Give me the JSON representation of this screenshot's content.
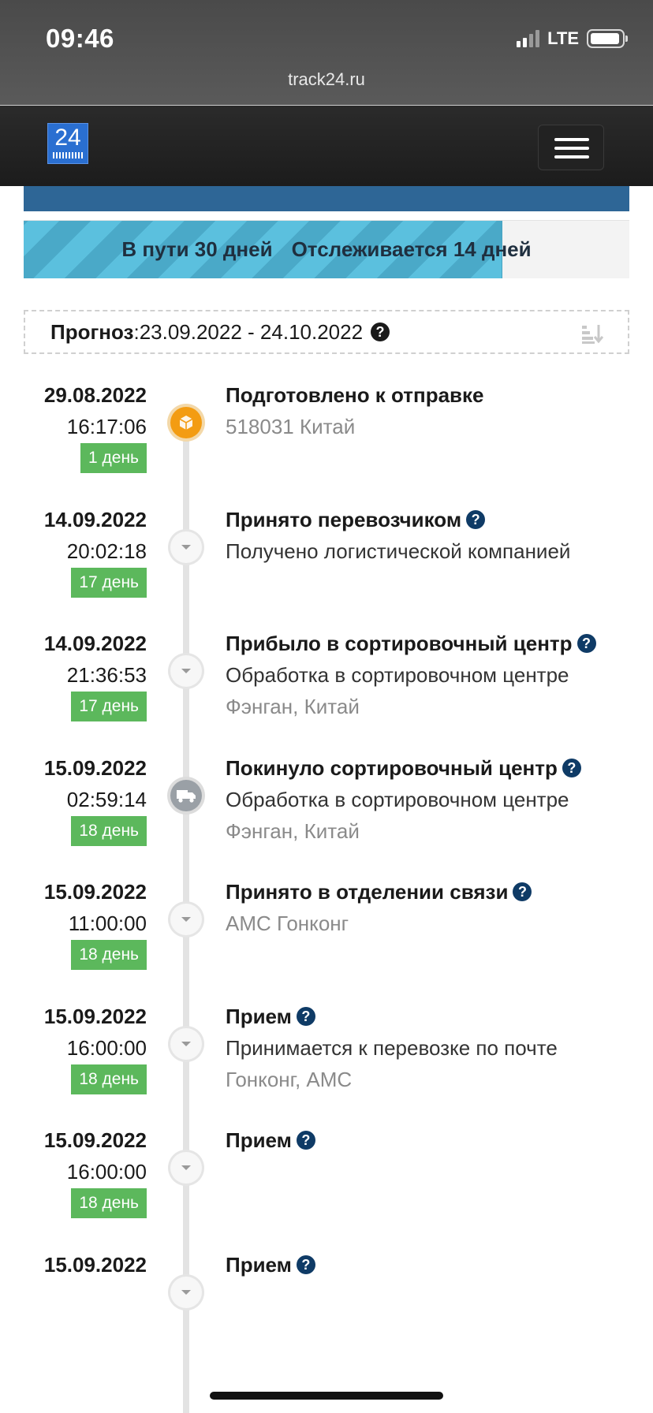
{
  "status_bar": {
    "time": "09:46",
    "network": "LTE",
    "url": "track24.ru"
  },
  "header": {
    "logo_text": "24",
    "menu_icon": "hamburger-icon"
  },
  "progress": {
    "in_transit": "В пути 30 дней",
    "tracked": "Отслеживается 14 дней",
    "fill_percent": 79
  },
  "forecast": {
    "label": "Прогноз",
    "separator": ":",
    "range": " 23.09.2022 - 24.10.2022"
  },
  "colors": {
    "badge": "#5cb85c",
    "help": "#0f3b66",
    "progress": "#5bc0de",
    "band": "#2e6696"
  },
  "events": [
    {
      "date": "29.08.2022",
      "time": "16:17:06",
      "day": "1 день",
      "title": "Подготовлено к отправке",
      "help": false,
      "desc": "518031 Китай",
      "desc_grey": true,
      "loc": "",
      "icon": "package-icon"
    },
    {
      "date": "14.09.2022",
      "time": "20:02:18",
      "day": "17 день",
      "title": "Принято перевозчиком",
      "help": true,
      "desc": "Получено логистической компанией",
      "desc_grey": false,
      "loc": "",
      "icon": "chevron-down-icon"
    },
    {
      "date": "14.09.2022",
      "time": "21:36:53",
      "day": "17 день",
      "title": "Прибыло в сортировочный центр",
      "help": true,
      "desc": "Обработка в сортировочном центре",
      "desc_grey": false,
      "loc": "Фэнган, Китай",
      "icon": "chevron-down-icon"
    },
    {
      "date": "15.09.2022",
      "time": "02:59:14",
      "day": "18 день",
      "title": "Покинуло сортировочный центр",
      "help": true,
      "desc": "Обработка в сортировочном центре",
      "desc_grey": false,
      "loc": "Фэнган, Китай",
      "icon": "truck-icon"
    },
    {
      "date": "15.09.2022",
      "time": "11:00:00",
      "day": "18 день",
      "title": "Принято в отделении связи",
      "help": true,
      "desc": "AMC Гонконг",
      "desc_grey": true,
      "loc": "",
      "icon": "chevron-down-icon"
    },
    {
      "date": "15.09.2022",
      "time": "16:00:00",
      "day": "18 день",
      "title": "Прием",
      "help": true,
      "desc": "Принимается к перевозке по почте",
      "desc_grey": false,
      "loc": "Гонконг, AMC",
      "icon": "chevron-down-icon"
    },
    {
      "date": "15.09.2022",
      "time": "16:00:00",
      "day": "18 день",
      "title": "Прием",
      "help": true,
      "desc": "",
      "desc_grey": false,
      "loc": "",
      "icon": "chevron-down-icon"
    },
    {
      "date": "15.09.2022",
      "time": "",
      "day": "",
      "title": "Прием",
      "help": true,
      "desc": "",
      "desc_grey": false,
      "loc": "",
      "icon": "chevron-down-icon"
    }
  ]
}
